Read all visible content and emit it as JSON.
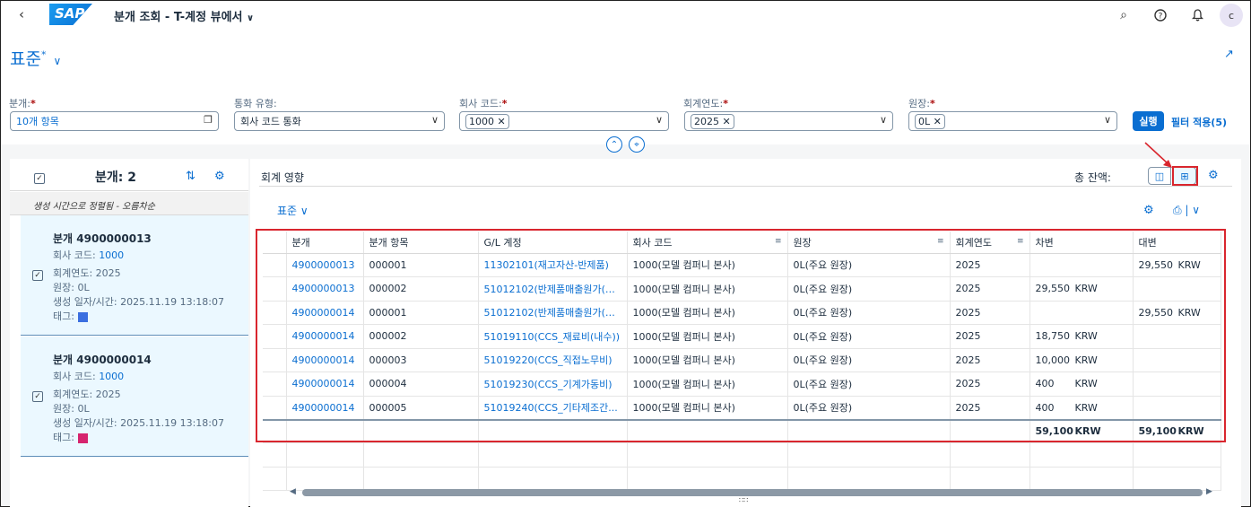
{
  "shell": {
    "back_icon": "chevron-left-icon",
    "logo": "SAP",
    "title": "분개 조회 - T-계정 뷰에서",
    "title_chevron": "∨",
    "icons": [
      "search-icon",
      "help-icon",
      "bell-icon"
    ],
    "avatar": "c"
  },
  "header": {
    "variant": "표준",
    "variant_marker": "*",
    "filters": [
      {
        "label": "분개:",
        "required": true,
        "value": "10개 항목"
      },
      {
        "label": "통화 유형:",
        "required": false,
        "value": "회사 코드 통화"
      },
      {
        "label": "회사 코드:",
        "required": true,
        "token": "1000"
      },
      {
        "label": "회계연도:",
        "required": true,
        "token": "2025"
      },
      {
        "label": "원장:",
        "required": true,
        "token": "0L"
      }
    ],
    "execute": "실행",
    "apply_filter": "필터 적용(5)"
  },
  "left_panel": {
    "title": "분개: 2",
    "sort_info": "생성 시간으로 정렬됨 - 오름차순",
    "items": [
      {
        "title_prefix": "분개 ",
        "title_num": "4900000013",
        "company_label": "회사 코드: ",
        "company": "1000",
        "year": "회계연도: 2025",
        "ledger": "원장: 0L",
        "created": "생성 일자/시간: 2025.11.19 13:18:07",
        "tag_label": "태그:",
        "tag_color": "#3b6fe0"
      },
      {
        "title_prefix": "분개 ",
        "title_num": "4900000014",
        "company_label": "회사 코드: ",
        "company": "1000",
        "year": "회계연도: 2025",
        "ledger": "원장: 0L",
        "created": "생성 일자/시간: 2025.11.19 13:18:07",
        "tag_label": "태그:",
        "tag_color": "#d6246e"
      }
    ]
  },
  "right_panel": {
    "title": "회계 영향",
    "total_label": "총 잔액:",
    "table_variant": "표준",
    "columns": [
      "분개",
      "분개 항목",
      "G/L 계정",
      "회사 코드",
      "원장",
      "회계연도",
      "차변",
      "대변"
    ],
    "rows": [
      {
        "je": "4900000013",
        "item": "000001",
        "gl": "11302101(재고자산-반제품)",
        "cc": "1000(모델 컴퍼니 본사)",
        "ledger": "0L(주요 원장)",
        "year": "2025",
        "debit": "",
        "debit_cur": "",
        "credit": "29,550",
        "credit_cur": "KRW"
      },
      {
        "je": "4900000013",
        "item": "000002",
        "gl": "51012102(반제품매출원가(VA...",
        "cc": "1000(모델 컴퍼니 본사)",
        "ledger": "0L(주요 원장)",
        "year": "2025",
        "debit": "29,550",
        "debit_cur": "KRW",
        "credit": "",
        "credit_cur": ""
      },
      {
        "je": "4900000014",
        "item": "000001",
        "gl": "51012102(반제품매출원가(VA...",
        "cc": "1000(모델 컴퍼니 본사)",
        "ledger": "0L(주요 원장)",
        "year": "2025",
        "debit": "",
        "debit_cur": "",
        "credit": "29,550",
        "credit_cur": "KRW"
      },
      {
        "je": "4900000014",
        "item": "000002",
        "gl": "51019110(CCS_재료비(내수))",
        "cc": "1000(모델 컴퍼니 본사)",
        "ledger": "0L(주요 원장)",
        "year": "2025",
        "debit": "18,750",
        "debit_cur": "KRW",
        "credit": "",
        "credit_cur": ""
      },
      {
        "je": "4900000014",
        "item": "000003",
        "gl": "51019220(CCS_직접노무비)",
        "cc": "1000(모델 컴퍼니 본사)",
        "ledger": "0L(주요 원장)",
        "year": "2025",
        "debit": "10,000",
        "debit_cur": "KRW",
        "credit": "",
        "credit_cur": ""
      },
      {
        "je": "4900000014",
        "item": "000004",
        "gl": "51019230(CCS_기계가동비)",
        "cc": "1000(모델 컴퍼니 본사)",
        "ledger": "0L(주요 원장)",
        "year": "2025",
        "debit": "400",
        "debit_cur": "KRW",
        "credit": "",
        "credit_cur": ""
      },
      {
        "je": "4900000014",
        "item": "000005",
        "gl": "51019240(CCS_기타제조간...",
        "cc": "1000(모델 컴퍼니 본사)",
        "ledger": "0L(주요 원장)",
        "year": "2025",
        "debit": "400",
        "debit_cur": "KRW",
        "credit": "",
        "credit_cur": ""
      }
    ],
    "sum": {
      "debit": "59,100",
      "debit_cur": "KRW",
      "credit": "59,100",
      "credit_cur": "KRW"
    }
  },
  "colors": {
    "accent": "#0a6ed1",
    "highlight": "#d9262e",
    "selected_bg": "#ebf8ff"
  }
}
